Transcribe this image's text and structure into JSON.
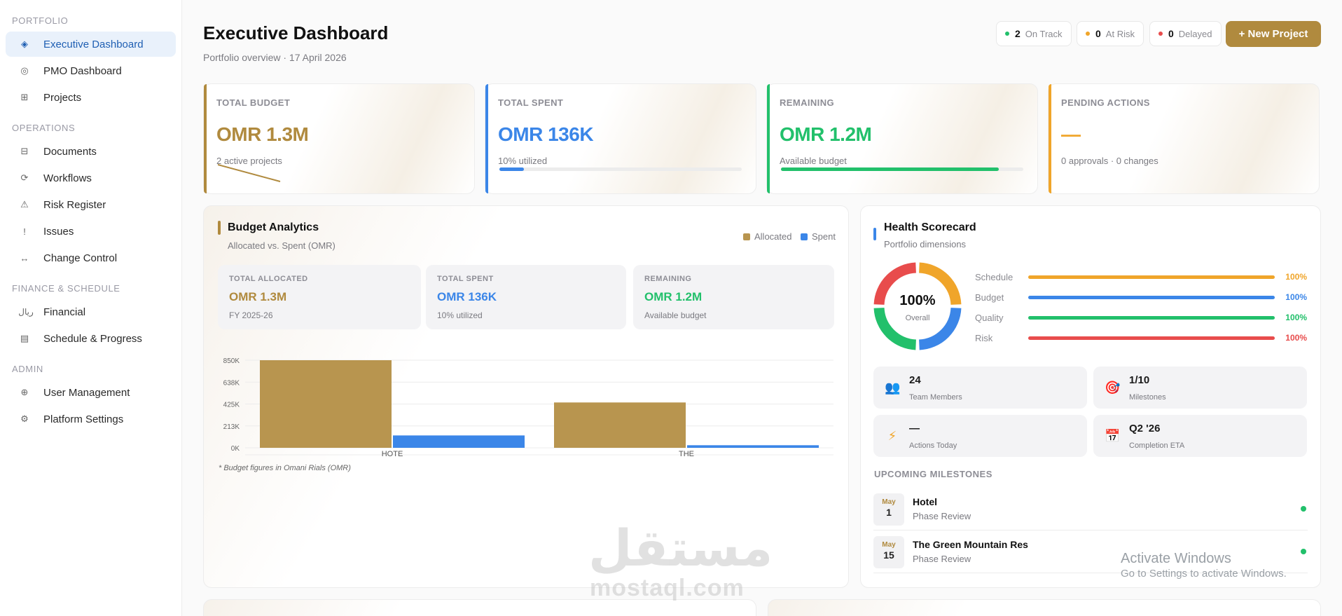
{
  "sidebar": {
    "sections": [
      {
        "label": "PORTFOLIO",
        "items": [
          {
            "label": "Executive Dashboard",
            "icon": "diamond-icon",
            "glyph": "◈",
            "active": true
          },
          {
            "label": "PMO Dashboard",
            "icon": "target-icon",
            "glyph": "◎"
          },
          {
            "label": "Projects",
            "icon": "grid-icon",
            "glyph": "⊞"
          }
        ]
      },
      {
        "label": "OPERATIONS",
        "items": [
          {
            "label": "Documents",
            "icon": "document-icon",
            "glyph": "⊟"
          },
          {
            "label": "Workflows",
            "icon": "refresh-icon",
            "glyph": "⟳"
          },
          {
            "label": "Risk Register",
            "icon": "warning-icon",
            "glyph": "⚠"
          },
          {
            "label": "Issues",
            "icon": "exclamation-icon",
            "glyph": "!"
          },
          {
            "label": "Change Control",
            "icon": "arrows-icon",
            "glyph": "↔"
          }
        ]
      },
      {
        "label": "FINANCE & SCHEDULE",
        "items": [
          {
            "label": "Financial",
            "icon": "rial-icon",
            "glyph": "ريال"
          },
          {
            "label": "Schedule & Progress",
            "icon": "calendar-icon",
            "glyph": "▤"
          }
        ]
      },
      {
        "label": "ADMIN",
        "items": [
          {
            "label": "User Management",
            "icon": "globe-icon",
            "glyph": "⊕"
          },
          {
            "label": "Platform Settings",
            "icon": "gear-icon",
            "glyph": "⚙"
          }
        ]
      }
    ]
  },
  "header": {
    "title": "Executive Dashboard",
    "subtitle": "Portfolio overview · 17 April 2026",
    "status": [
      {
        "count": "2",
        "label": "On Track",
        "color": "#22c06b"
      },
      {
        "count": "0",
        "label": "At Risk",
        "color": "#f0a52a"
      },
      {
        "count": "0",
        "label": "Delayed",
        "color": "#e84c4c"
      }
    ],
    "new_project": "+ New Project"
  },
  "kpis": [
    {
      "label": "TOTAL BUDGET",
      "value": "OMR 1.3M",
      "sub": "2 active projects",
      "color": "#b08a3e"
    },
    {
      "label": "TOTAL SPENT",
      "value": "OMR 136K",
      "sub": "10% utilized",
      "color": "#3b86e8",
      "progress": 0.1
    },
    {
      "label": "REMAINING",
      "value": "OMR 1.2M",
      "sub": "Available budget",
      "color": "#22c06b",
      "progress": 0.9
    },
    {
      "label": "PENDING ACTIONS",
      "value": "—",
      "sub": "0 approvals · 0 changes",
      "color": "#f0a52a"
    }
  ],
  "budget": {
    "title": "Budget Analytics",
    "subtitle": "Allocated vs. Spent (OMR)",
    "legend": [
      {
        "label": "Allocated",
        "color": "#b8954f"
      },
      {
        "label": "Spent",
        "color": "#3b86e8"
      }
    ],
    "cards": [
      {
        "label": "TOTAL ALLOCATED",
        "value": "OMR 1.3M",
        "sub": "FY 2025-26",
        "color": "#b08a3e"
      },
      {
        "label": "TOTAL SPENT",
        "value": "OMR 136K",
        "sub": "10% utilized",
        "color": "#3b86e8"
      },
      {
        "label": "REMAINING",
        "value": "OMR 1.2M",
        "sub": "Available budget",
        "color": "#22c06b"
      }
    ],
    "note": "* Budget figures in Omani Rials (OMR)"
  },
  "chart_data": {
    "type": "bar",
    "categories": [
      "HOTE",
      "THE"
    ],
    "series": [
      {
        "name": "Allocated",
        "values": [
          850000,
          440000
        ],
        "color": "#b8954f"
      },
      {
        "name": "Spent",
        "values": [
          120000,
          25000
        ],
        "color": "#3b86e8"
      }
    ],
    "yticks": [
      "0K",
      "213K",
      "425K",
      "638K",
      "850K"
    ],
    "ylim": [
      0,
      850000
    ]
  },
  "health": {
    "title": "Health Scorecard",
    "subtitle": "Portfolio dimensions",
    "overall": "100%",
    "overall_label": "Overall",
    "rows": [
      {
        "name": "Schedule",
        "pct": "100%",
        "color": "#f0a52a"
      },
      {
        "name": "Budget",
        "pct": "100%",
        "color": "#3b86e8"
      },
      {
        "name": "Quality",
        "pct": "100%",
        "color": "#22c06b"
      },
      {
        "name": "Risk",
        "pct": "100%",
        "color": "#e84c4c"
      }
    ],
    "stats": [
      {
        "value": "24",
        "label": "Team Members",
        "icon": "team-icon",
        "glyph": "👥"
      },
      {
        "value": "1/10",
        "label": "Milestones",
        "icon": "target-icon",
        "glyph": "🎯"
      },
      {
        "value": "—",
        "label": "Actions Today",
        "icon": "lightning-icon",
        "glyph": "⚡"
      },
      {
        "value": "Q2 '26",
        "label": "Completion ETA",
        "icon": "calendar-icon",
        "glyph": "📅"
      }
    ],
    "milestones_title": "UPCOMING MILESTONES",
    "milestones": [
      {
        "month": "May",
        "day": "1",
        "title": "Hotel",
        "phase": "Phase Review"
      },
      {
        "month": "May",
        "day": "15",
        "title": "The Green Mountain Res",
        "phase": "Phase Review"
      }
    ]
  },
  "overlay": {
    "watermark_ar": "مستقل",
    "watermark_en": "mostaql.com",
    "activate_title": "Activate Windows",
    "activate_sub": "Go to Settings to activate Windows."
  }
}
